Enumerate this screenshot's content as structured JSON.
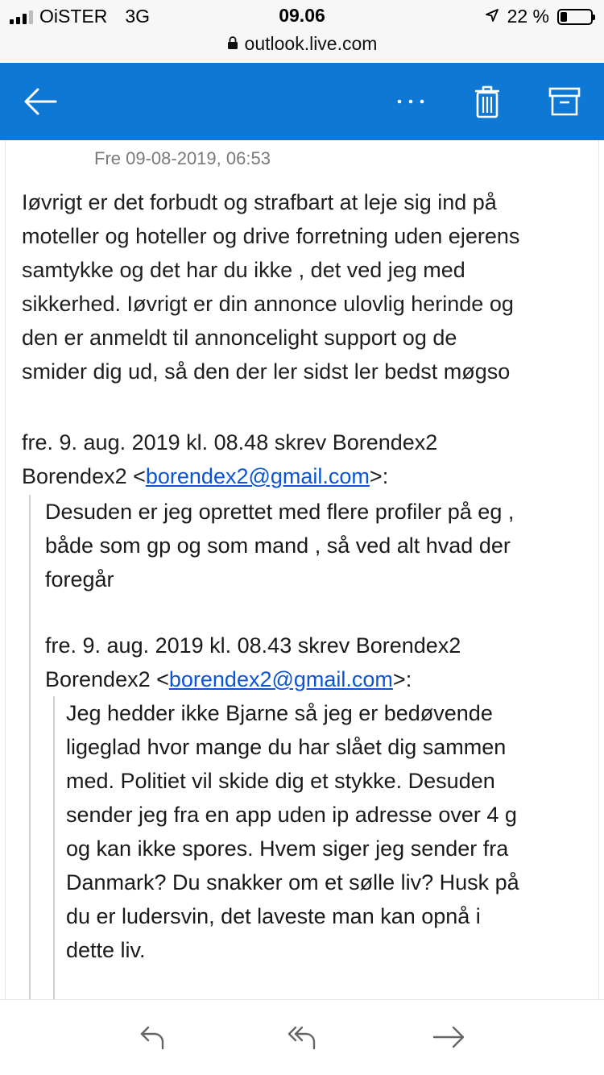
{
  "status_bar": {
    "carrier": "OiSTER",
    "network": "3G",
    "time": "09.06",
    "battery_percent": "22 %",
    "battery_level": 0.22
  },
  "browser": {
    "url": "outlook.live.com"
  },
  "toolbar": {
    "icons": [
      "back-arrow-icon",
      "more-icon",
      "trash-icon",
      "archive-icon"
    ],
    "accent_color": "#0f78d4"
  },
  "email": {
    "sent_date": "Fre 09-08-2019, 06:53",
    "body_lines": [
      "Iøvrigt er det forbudt og strafbart at leje sig ind på",
      "moteller og hoteller og drive forretning uden ejerens",
      "samtykke og det har du ikke , det ved jeg med",
      "sikkerhed. Iøvrigt er din annonce ulovlig herinde og",
      "den er anmeldt til annoncelight support og de",
      "smider dig ud, så den der ler sidst ler bedst møgso"
    ],
    "quote1": {
      "attribution_line1": "fre. 9. aug. 2019 kl. 08.48 skrev Borendex2",
      "attribution_prefix": "Borendex2 <",
      "email_link": "borendex2@gmail.com",
      "attribution_suffix": ">:",
      "lines": [
        "Desuden er jeg oprettet med flere profiler på eg ,",
        "både som gp og som mand , så ved alt hvad der",
        "foregår"
      ]
    },
    "quote2": {
      "attribution_line1": "fre. 9. aug. 2019 kl. 08.43 skrev Borendex2",
      "attribution_prefix": "Borendex2 <",
      "email_link": "borendex2@gmail.com",
      "attribution_suffix": ">:",
      "lines": [
        "Jeg hedder ikke Bjarne så jeg er bedøvende",
        "ligeglad hvor mange du har slået dig sammen",
        "med. Politiet vil skide dig et stykke. Desuden",
        "sender jeg fra en app uden ip adresse over 4 g",
        "og kan ikke spores. Hvem siger jeg sender fra",
        "Danmark? Du snakker om et sølle liv? Husk på",
        "du er ludersvin, det laveste man kan opnå i",
        "dette liv."
      ]
    }
  },
  "bottom_bar": {
    "icons": [
      "reply-icon",
      "reply-all-icon",
      "forward-icon"
    ]
  }
}
